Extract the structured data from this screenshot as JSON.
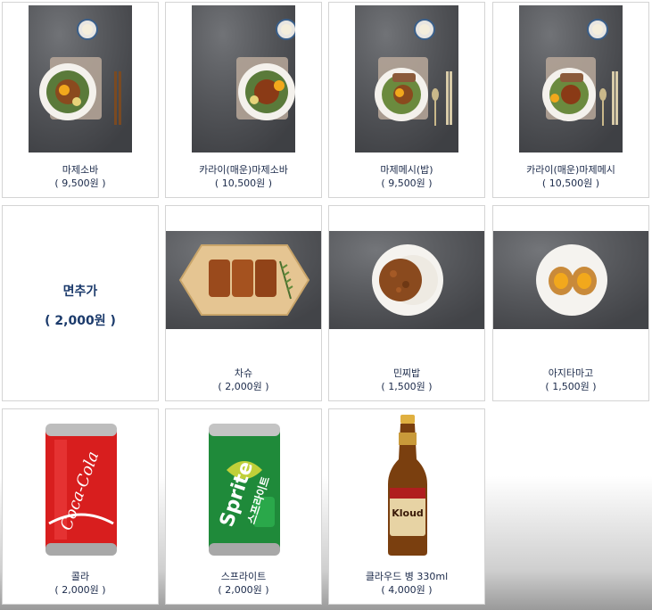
{
  "menu": [
    {
      "name": "마제소바",
      "price": "( 9,500원 )",
      "icon": "mazesoba-photo"
    },
    {
      "name": "카라이(매운)마제소바",
      "price": "( 10,500원 )",
      "icon": "spicy-mazesoba-photo"
    },
    {
      "name": "마제메시(밥)",
      "price": "( 9,500원 )",
      "icon": "mazemeshi-photo"
    },
    {
      "name": "카라이(매운)마제메시",
      "price": "( 10,500원 )",
      "icon": "spicy-mazemeshi-photo"
    },
    {
      "name": "면추가",
      "price": "( 2,000원 )",
      "icon": ""
    },
    {
      "name": "차슈",
      "price": "( 2,000원 )",
      "icon": "chashu-photo"
    },
    {
      "name": "민찌밥",
      "price": "( 1,500원 )",
      "icon": "minced-meat-rice-photo"
    },
    {
      "name": "아지타마고",
      "price": "( 1,500원 )",
      "icon": "marinated-egg-photo"
    },
    {
      "name": "콜라",
      "price": "( 2,000원 )",
      "icon": "coca-cola-can-photo"
    },
    {
      "name": "스프라이트",
      "price": "( 2,000원 )",
      "icon": "sprite-can-photo"
    },
    {
      "name": "클라우드 병 330ml",
      "price": "( 4,000원 )",
      "icon": "kloud-beer-bottle-photo"
    }
  ],
  "labels": {
    "coke_can": "Coca-Cola",
    "sprite_can": "Sprite",
    "sprite_korean": "스프라이트",
    "beer_label": "Kloud"
  },
  "colors": {
    "text": "#1b2a4a",
    "accent_text": "#1b3a6b",
    "card_border": "#d4d4d4",
    "coke_red": "#d81e1e",
    "sprite_green": "#1f8a3a",
    "beer_brown": "#7a3f0f"
  }
}
